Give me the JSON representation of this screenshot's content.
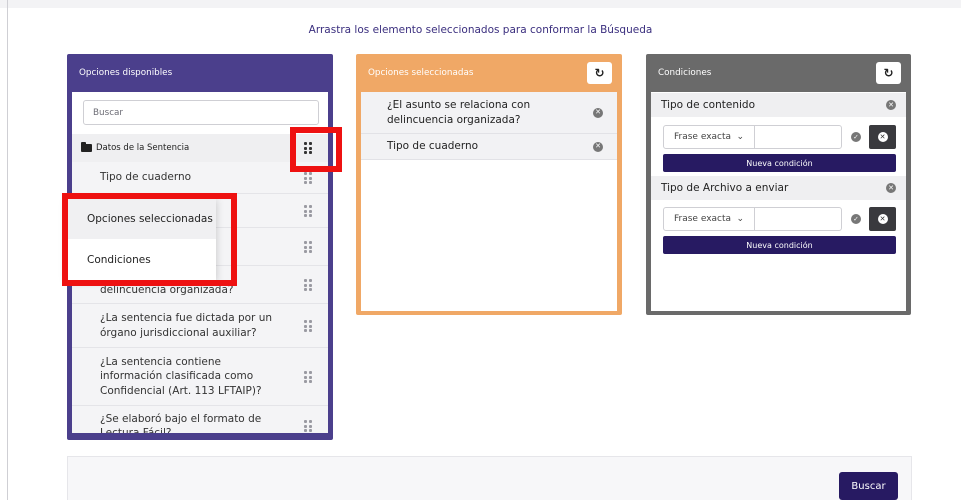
{
  "instruction": "Arrastra los elemento seleccionados para conformar la Búsqueda",
  "reset_symbol": "↻",
  "available": {
    "title": "Opciones disponibles",
    "search_placeholder": "Buscar",
    "folder_label": "Datos de la Sentencia",
    "items": [
      "Tipo de cuaderno",
      "delincuencia organizada?",
      "¿La sentencia fue dictada por un órgano jurisdiccional auxiliar?",
      "¿La sentencia contiene información clasificada como Confidencial (Art. 113 LFTAIP)?",
      "¿Se elaboró bajo el formato de Lectura Fácil?"
    ]
  },
  "dropdown": {
    "items": [
      "Opciones seleccionadas",
      "Condiciones"
    ]
  },
  "selected": {
    "title": "Opciones seleccionadas",
    "items": [
      "¿El asunto se relaciona con delincuencia organizada?",
      "Tipo de cuaderno"
    ]
  },
  "conditions": {
    "title": "Condiciones",
    "groups": [
      {
        "label": "Tipo de contenido",
        "match_type": "Frase exacta",
        "value": "",
        "new_label": "Nueva condición"
      },
      {
        "label": "Tipo de Archivo a enviar",
        "match_type": "Frase exacta",
        "value": "",
        "new_label": "Nueva condición"
      }
    ]
  },
  "footer": {
    "search_button": "Buscar"
  },
  "colors": {
    "available_panel": "#4b3f8c",
    "selected_panel": "#f0a866",
    "conditions_panel": "#6a6a6a",
    "primary_button": "#271a62",
    "highlight": "#ee1111"
  }
}
